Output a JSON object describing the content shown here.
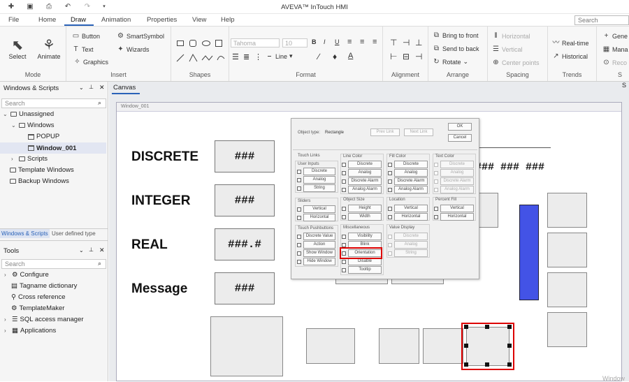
{
  "app": {
    "title": "AVEVA™ InTouch HMI"
  },
  "menu": {
    "tabs": [
      "File",
      "Home",
      "Draw",
      "Animation",
      "Properties",
      "View",
      "Help"
    ],
    "active": "Draw",
    "search_placeholder": "Search"
  },
  "ribbon": {
    "mode": {
      "label": "Mode",
      "select": "Select",
      "animate": "Animate"
    },
    "insert": {
      "label": "Insert",
      "button": "Button",
      "text": "Text",
      "graphics": "Graphics",
      "smartsymbol": "SmartSymbol",
      "wizards": "Wizards"
    },
    "shapes": {
      "label": "Shapes"
    },
    "format": {
      "label": "Format",
      "font": "Tahoma",
      "size": "10",
      "line": "Line"
    },
    "alignment": {
      "label": "Alignment"
    },
    "arrange": {
      "label": "Arrange",
      "bring_to_front": "Bring to front",
      "send_to_back": "Send to back",
      "rotate": "Rotate"
    },
    "spacing": {
      "label": "Spacing",
      "horizontal": "Horizontal",
      "vertical": "Vertical",
      "center_points": "Center points"
    },
    "trends": {
      "label": "Trends",
      "realtime": "Real-time",
      "historical": "Historical"
    },
    "extra": {
      "gene": "Gene",
      "mana": "Mana",
      "reco": "Reco",
      "s": "S"
    }
  },
  "left_panel": {
    "title": "Windows & Scripts",
    "search_placeholder": "Search",
    "tree": {
      "unassigned": "Unassigned",
      "windows": "Windows",
      "popup": "POPUP",
      "window_001": "Window_001",
      "scripts": "Scripts",
      "template_windows": "Template Windows",
      "backup_windows": "Backup Windows"
    },
    "tabs": [
      "Windows & Scripts",
      "User defined type"
    ]
  },
  "tools_panel": {
    "title": "Tools",
    "search_placeholder": "Search",
    "items": [
      "Configure",
      "Tagname dictionary",
      "Cross reference",
      "TemplateMaker",
      "SQL access manager",
      "Applications"
    ]
  },
  "canvas": {
    "tab": "Canvas",
    "window_name": "Window_001",
    "labels": [
      "DISCRETE",
      "INTEGER",
      "REAL",
      "Message"
    ],
    "values": [
      "###",
      "###",
      "###.#",
      "###"
    ],
    "hashes": "### ### ###",
    "watermark": "Window"
  },
  "dialog": {
    "object_type_label": "Object type:",
    "object_type": "Rectangle",
    "prev_link": "Prev Link",
    "next_link": "Next Link",
    "ok": "OK",
    "cancel": "Cancel",
    "touch_links": "Touch Links",
    "user_inputs": "User Inputs",
    "ui_items": [
      "Discrete",
      "Analog",
      "String"
    ],
    "sliders": "Sliders",
    "slider_items": [
      "Vertical",
      "Horizontal"
    ],
    "touch_pushbuttons": "Touch Pushbuttons",
    "tp_items": [
      "Discrete Value",
      "Action",
      "Show Window",
      "Hide Window"
    ],
    "line_color": "Line Color",
    "lc_items": [
      "Discrete",
      "Analog",
      "Discrete Alarm",
      "Analog Alarm"
    ],
    "fill_color": "Fill Color",
    "fc_items": [
      "Discrete",
      "Analog",
      "Discrete Alarm",
      "Analog Alarm"
    ],
    "text_color": "Text Color",
    "tc_items": [
      "Discrete",
      "Analog",
      "Discrete Alarm",
      "Analog Alarm"
    ],
    "object_size": "Object Size",
    "os_items": [
      "Height",
      "Width"
    ],
    "location": "Location",
    "loc_items": [
      "Vertical",
      "Horizontal"
    ],
    "percent_fill": "Percent Fill",
    "pf_items": [
      "Vertical",
      "Horizontal"
    ],
    "miscellaneous": "Miscellaneous",
    "misc_items": [
      "Visibility",
      "Blink",
      "Orientation",
      "Disable",
      "Tooltip"
    ],
    "value_display": "Value Display",
    "vd_items": [
      "Discrete",
      "Analog",
      "String"
    ]
  },
  "colors": {
    "accent": "#2a62b8",
    "highlight": "#dd0000",
    "bar": "#4353e6"
  }
}
